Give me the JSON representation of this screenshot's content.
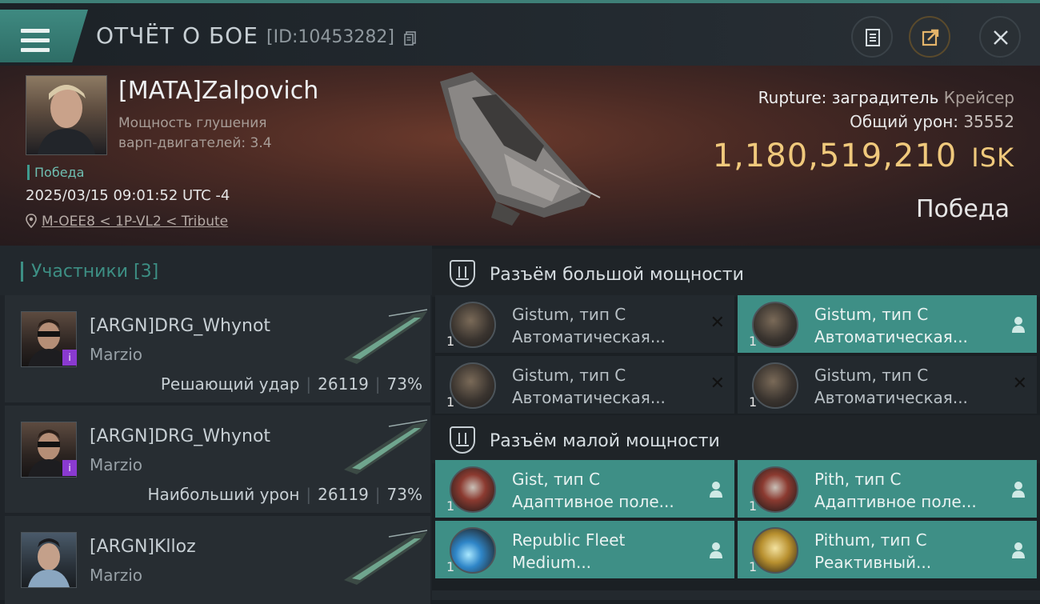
{
  "header": {
    "title": "ОТЧЁТ О БОЕ",
    "report_id": "[ID:10453282]"
  },
  "victim": {
    "name": "[MATA]Zalpovich",
    "warp_label_1": "Мощность глушения",
    "warp_label_2": "варп-двигателей: 3.4",
    "status": "Победа",
    "datetime": "2025/03/15 09:01:52 UTC -4",
    "location": "M-OEE8 < 1P-VL2 < Tribute",
    "ship_name": "Rupture: заградитель",
    "ship_class": "Крейсер",
    "damage_label": "Общий урон:",
    "damage_value": "35552",
    "isk_value": "1,180,519,210",
    "isk_unit": "ISK",
    "result": "Победа"
  },
  "participants": {
    "title": "Участники [3]",
    "rows": [
      {
        "name": "[ARGN]DRG_Whynot",
        "corp": "Marzio",
        "role": "Решающий удар",
        "damage": "26119",
        "percent": "73%",
        "badge": "i"
      },
      {
        "name": "[ARGN]DRG_Whynot",
        "corp": "Marzio",
        "role": "Наибольший урон",
        "damage": "26119",
        "percent": "73%",
        "badge": "i"
      },
      {
        "name": "[ARGN]Klloz",
        "corp": "Marzio"
      }
    ]
  },
  "modules": {
    "high_title": "Разъём большой мощности",
    "low_title": "Разъём малой мощности",
    "high": [
      {
        "qty": "1",
        "name": "Gistum, тип C",
        "desc": "Автоматическая...",
        "state": "destroyed"
      },
      {
        "qty": "1",
        "name": "Gistum, тип C",
        "desc": "Автоматическая...",
        "state": "dropped"
      },
      {
        "qty": "1",
        "name": "Gistum, тип C",
        "desc": "Автоматическая...",
        "state": "destroyed"
      },
      {
        "qty": "1",
        "name": "Gistum, тип C",
        "desc": "Автоматическая...",
        "state": "destroyed"
      }
    ],
    "low": [
      {
        "qty": "1",
        "name": "Gist, тип C",
        "desc": "Адаптивное поле...",
        "state": "dropped"
      },
      {
        "qty": "1",
        "name": "Pith, тип C",
        "desc": "Адаптивное поле...",
        "state": "dropped"
      },
      {
        "qty": "1",
        "name": "Republic Fleet",
        "desc": "Medium...",
        "state": "dropped"
      },
      {
        "qty": "1",
        "name": "Pithum, тип C",
        "desc": "Реактивный...",
        "state": "dropped"
      }
    ]
  },
  "icons": {
    "menu": "hamburger-icon",
    "copy": "copy-icon",
    "clipboard": "clipboard-icon",
    "export": "export-icon",
    "close": "close-icon",
    "location": "location-pin-icon"
  },
  "colors": {
    "accent": "#3e8f86",
    "isk": "#f0c97c",
    "badge": "#8a3ad0"
  }
}
